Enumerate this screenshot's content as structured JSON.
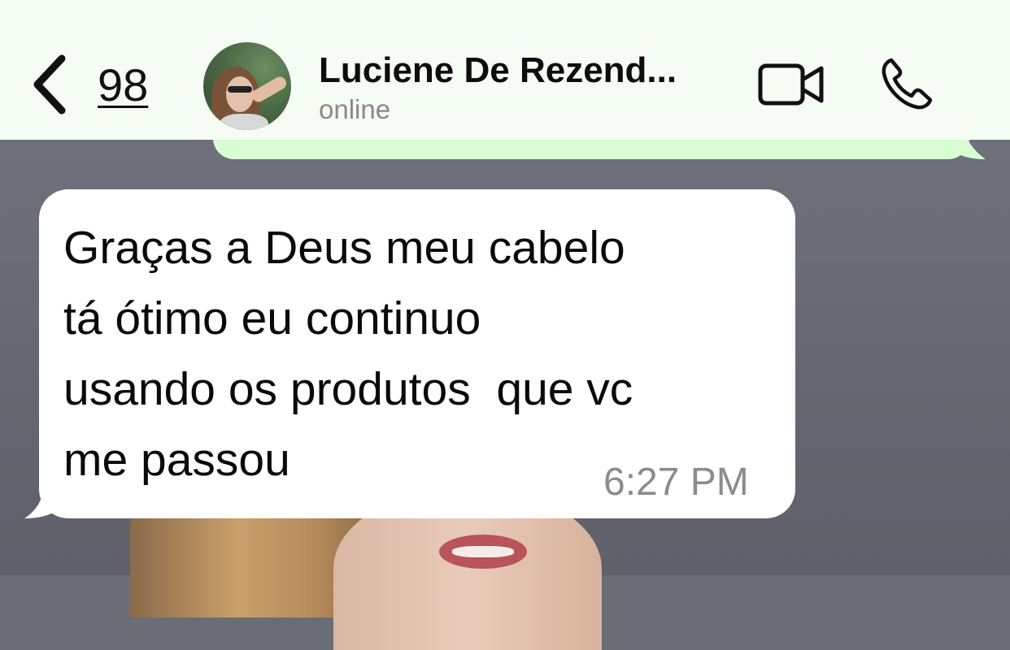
{
  "header": {
    "back_count": "98",
    "contact_name": "Luciene De Rezend...",
    "status": "online",
    "video_icon": "video-camera-icon",
    "call_icon": "phone-icon"
  },
  "messages": [
    {
      "direction": "incoming",
      "text": "Graças a Deus meu cabelo\ntá ótimo eu continuo\nusando os produtos  que vc\nme passou",
      "time": "6:27 PM"
    }
  ],
  "colors": {
    "header_bg": "#f5fcf3",
    "outgoing_bubble": "#d8fdd2",
    "incoming_bubble": "#ffffff",
    "status_gray": "#8a8a8a"
  }
}
